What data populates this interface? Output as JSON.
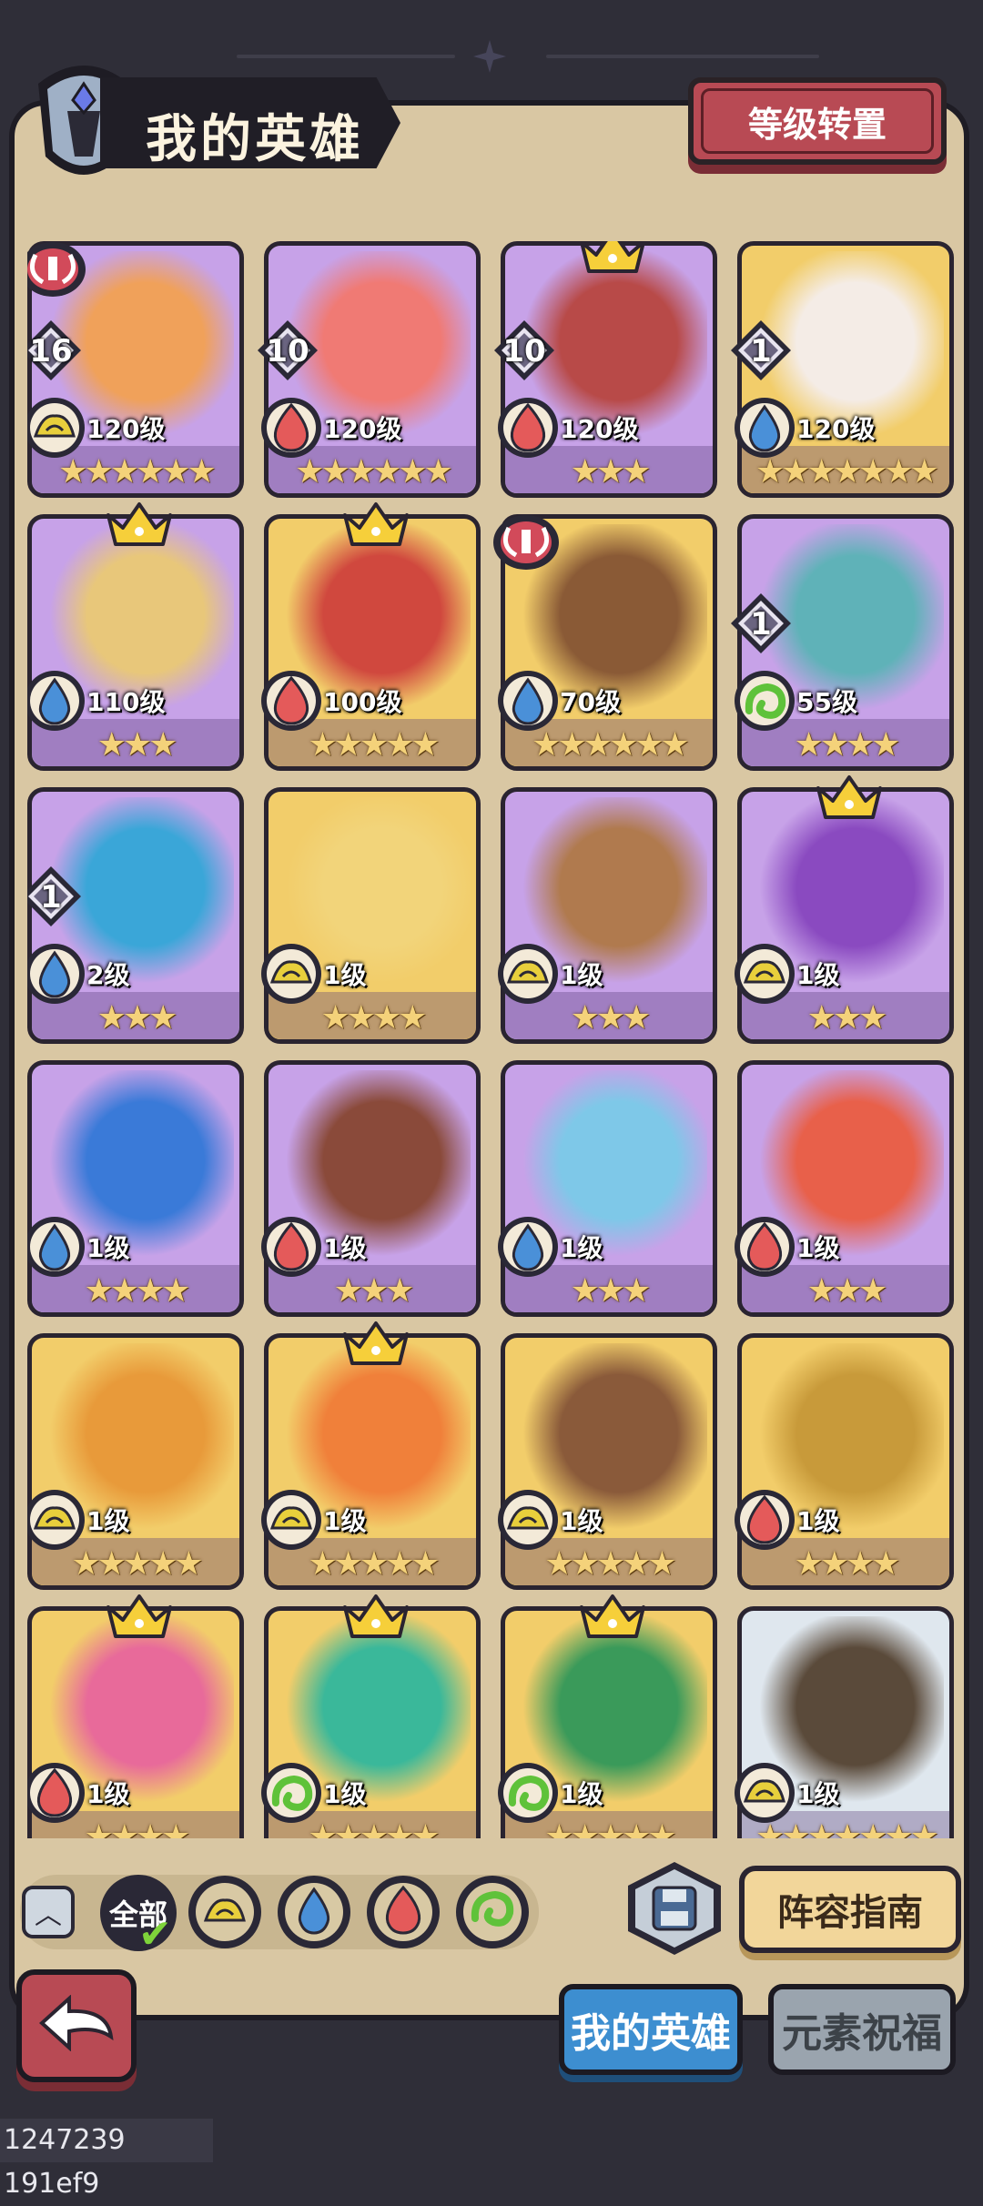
{
  "header": {
    "title": "我的英雄",
    "level_transfer_button": "等级转置"
  },
  "colors": {
    "earth": "#e8cf3c",
    "water": "#4a90d8",
    "fire": "#e45a5a",
    "wind": "#5fc23a",
    "card_purple": "#c7a2e8",
    "card_gold": "#f2cd6a",
    "card_silver": "#dfe7ee"
  },
  "heroes": [
    {
      "level": "120级",
      "element": "earth",
      "stars": "★★★★★★",
      "badge": "16",
      "crown": false,
      "horn": true,
      "rarity": "purple",
      "portrait": "#f0a15a"
    },
    {
      "level": "120级",
      "element": "fire",
      "stars": "★★★★★★",
      "badge": "10",
      "crown": false,
      "horn": false,
      "rarity": "purple",
      "portrait": "#f07a74"
    },
    {
      "level": "120级",
      "element": "fire",
      "stars": "★★★",
      "badge": "10",
      "crown": true,
      "horn": false,
      "rarity": "purple",
      "portrait": "#b84a48"
    },
    {
      "level": "120级",
      "element": "water",
      "stars": "★★★★★★★",
      "badge": "1",
      "crown": false,
      "horn": false,
      "rarity": "gold",
      "portrait": "#f4ece6"
    },
    {
      "level": "110级",
      "element": "water",
      "stars": "★★★",
      "badge": "",
      "crown": true,
      "horn": false,
      "rarity": "purple",
      "portrait": "#e8c77a"
    },
    {
      "level": "100级",
      "element": "fire",
      "stars": "★★★★★",
      "badge": "",
      "crown": true,
      "horn": false,
      "rarity": "gold",
      "portrait": "#d0483e"
    },
    {
      "level": "70级",
      "element": "water",
      "stars": "★★★★★★",
      "badge": "",
      "crown": false,
      "horn": true,
      "rarity": "gold",
      "portrait": "#8a5a36"
    },
    {
      "level": "55级",
      "element": "wind",
      "stars": "★★★★",
      "badge": "1",
      "crown": false,
      "horn": false,
      "rarity": "purple",
      "portrait": "#5fb2b8"
    },
    {
      "level": "2级",
      "element": "water",
      "stars": "★★★",
      "badge": "1",
      "crown": false,
      "horn": false,
      "rarity": "purple",
      "portrait": "#3aa6d8"
    },
    {
      "level": "1级",
      "element": "earth",
      "stars": "★★★★",
      "badge": "",
      "crown": false,
      "horn": false,
      "rarity": "gold",
      "portrait": "#f2d47a"
    },
    {
      "level": "1级",
      "element": "earth",
      "stars": "★★★",
      "badge": "",
      "crown": false,
      "horn": false,
      "rarity": "purple",
      "portrait": "#b07a4e"
    },
    {
      "level": "1级",
      "element": "earth",
      "stars": "★★★",
      "badge": "",
      "crown": true,
      "horn": false,
      "rarity": "purple",
      "portrait": "#8a4ac0"
    },
    {
      "level": "1级",
      "element": "water",
      "stars": "★★★★",
      "badge": "",
      "crown": false,
      "horn": false,
      "rarity": "purple",
      "portrait": "#3a7ad8"
    },
    {
      "level": "1级",
      "element": "fire",
      "stars": "★★★",
      "badge": "",
      "crown": false,
      "horn": false,
      "rarity": "purple",
      "portrait": "#8a4a3a"
    },
    {
      "level": "1级",
      "element": "water",
      "stars": "★★★",
      "badge": "",
      "crown": false,
      "horn": false,
      "rarity": "purple",
      "portrait": "#7ec8e8"
    },
    {
      "level": "1级",
      "element": "fire",
      "stars": "★★★",
      "badge": "",
      "crown": false,
      "horn": false,
      "rarity": "purple",
      "portrait": "#e8604a"
    },
    {
      "level": "1级",
      "element": "earth",
      "stars": "★★★★★",
      "badge": "",
      "crown": false,
      "horn": false,
      "rarity": "gold",
      "portrait": "#e89a3a"
    },
    {
      "level": "1级",
      "element": "earth",
      "stars": "★★★★★",
      "badge": "",
      "crown": true,
      "horn": false,
      "rarity": "gold",
      "portrait": "#f0803a"
    },
    {
      "level": "1级",
      "element": "earth",
      "stars": "★★★★★",
      "badge": "",
      "crown": false,
      "horn": false,
      "rarity": "gold",
      "portrait": "#8a5a3a"
    },
    {
      "level": "1级",
      "element": "fire",
      "stars": "★★★★",
      "badge": "",
      "crown": false,
      "horn": false,
      "rarity": "gold",
      "portrait": "#c89a3a"
    },
    {
      "level": "1级",
      "element": "fire",
      "stars": "★★★★",
      "badge": "",
      "crown": true,
      "horn": false,
      "rarity": "gold",
      "portrait": "#e86a9a"
    },
    {
      "level": "1级",
      "element": "wind",
      "stars": "★★★★★",
      "badge": "",
      "crown": true,
      "horn": false,
      "rarity": "gold",
      "portrait": "#3ab89a"
    },
    {
      "level": "1级",
      "element": "wind",
      "stars": "★★★★★",
      "badge": "",
      "crown": true,
      "horn": false,
      "rarity": "gold",
      "portrait": "#3a9a5a"
    },
    {
      "level": "1级",
      "element": "earth",
      "stars": "★★★★★★★",
      "badge": "",
      "crown": false,
      "horn": false,
      "rarity": "silver",
      "portrait": "#5a4a3a"
    }
  ],
  "filter": {
    "all_label": "全部",
    "elements": [
      "earth",
      "water",
      "fire",
      "wind"
    ]
  },
  "guide_button": "阵容指南",
  "tabs": {
    "my_heroes": "我的英雄",
    "element_blessing": "元素祝福"
  },
  "debug_text": "1247239 191ef9"
}
